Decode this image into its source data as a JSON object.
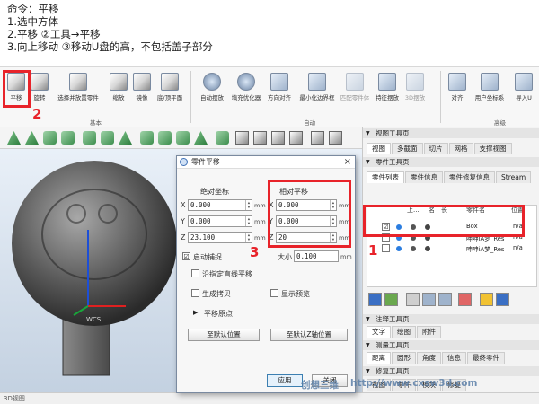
{
  "instructions": {
    "line1": "命令：平移",
    "line2": "1.选中方体",
    "line3": "2.平移          ②工具→平移",
    "line4": "3.向上移动      ③移动U盘的高，不包括盖子部分"
  },
  "ribbon": {
    "items": [
      {
        "label": "平移",
        "icon": "move-icon"
      },
      {
        "label": "旋转",
        "icon": "rotate-icon"
      },
      {
        "label": "选择并放置零件",
        "icon": "place-part-icon"
      },
      {
        "label": "缩放",
        "icon": "scale-icon"
      },
      {
        "label": "镜像",
        "icon": "mirror-icon"
      },
      {
        "label": "底/顶平面",
        "icon": "plane-icon"
      },
      {
        "label": "自动摆放",
        "icon": "auto-place-icon"
      },
      {
        "label": "填充优化器",
        "icon": "nest-icon"
      },
      {
        "label": "方向对齐",
        "icon": "align-icon"
      },
      {
        "label": "最小化边界框",
        "icon": "min-bbox-icon"
      },
      {
        "label": "匹配零件体",
        "icon": "match-icon"
      },
      {
        "label": "特征摆放",
        "icon": "feature-icon"
      },
      {
        "label": "3D摆放",
        "icon": "place3d-icon"
      },
      {
        "label": "对齐",
        "icon": "align2-icon"
      },
      {
        "label": "用户坐标系",
        "icon": "ucs-icon"
      },
      {
        "label": "导入U",
        "icon": "import-icon"
      }
    ],
    "groups": [
      "基本",
      "自动",
      "高级"
    ]
  },
  "right_panel": {
    "view_toolbar": "视图工具页",
    "view_tabs": [
      "视图",
      "多截面",
      "切片",
      "网格",
      "支撑视图"
    ],
    "part_toolbar": "零件工具页",
    "part_tabs": [
      "零件列表",
      "零件信息",
      "零件修复信息",
      "Stream"
    ],
    "columns": [
      "",
      "",
      "",
      "上...",
      "名",
      "长",
      "",
      "零件名",
      "位置"
    ],
    "rows": [
      {
        "name": "Box",
        "pos": "n/a"
      },
      {
        "name": "呻呻iA梦_Res",
        "pos": "n/a"
      },
      {
        "name": "呻呻iA梦_Res",
        "pos": "n/a"
      }
    ],
    "note_toolbar": "注释工具页",
    "note_tabs": [
      "文字",
      "绘图",
      "附件"
    ],
    "measure_toolbar": "测量工具页",
    "measure_tabs": [
      "距离",
      "圆形",
      "角度",
      "信息",
      "最终零件"
    ],
    "repair_toolbar": "修复工具页",
    "repair_bottom": [
      "视图",
      "零件",
      "模块",
      "修复"
    ]
  },
  "dialog": {
    "title": "零件平移",
    "abs_label": "绝对坐标",
    "rel_label": "相对平移",
    "abs": {
      "x": "0.000",
      "y": "0.000",
      "z": "23.100"
    },
    "rel": {
      "x": "0.000",
      "y": "0.000",
      "z": "20"
    },
    "unit": "mm",
    "snap_label": "启动捕捉",
    "size_label": "大小",
    "size_value": "0.100",
    "along_axis": "沿指定直线平移",
    "gen_copy": "生成拷贝",
    "show_preview": "显示预览",
    "translate_origin": "平移原点",
    "btn_default": "至默认位置",
    "btn_z_default": "至默认Z轴位置",
    "btn_apply": "应用",
    "btn_close": "关闭"
  },
  "markers": {
    "one": "1",
    "two": "2",
    "three": "3"
  },
  "viewport": {
    "wcs": "WCS"
  },
  "status": {
    "text": "3D视图"
  },
  "watermark": {
    "text": "http://www.cxsw3d.com",
    "side": "创想三维"
  },
  "colors": {
    "accent_red": "#e8232a",
    "brand_blue": "#3d6fb5"
  }
}
